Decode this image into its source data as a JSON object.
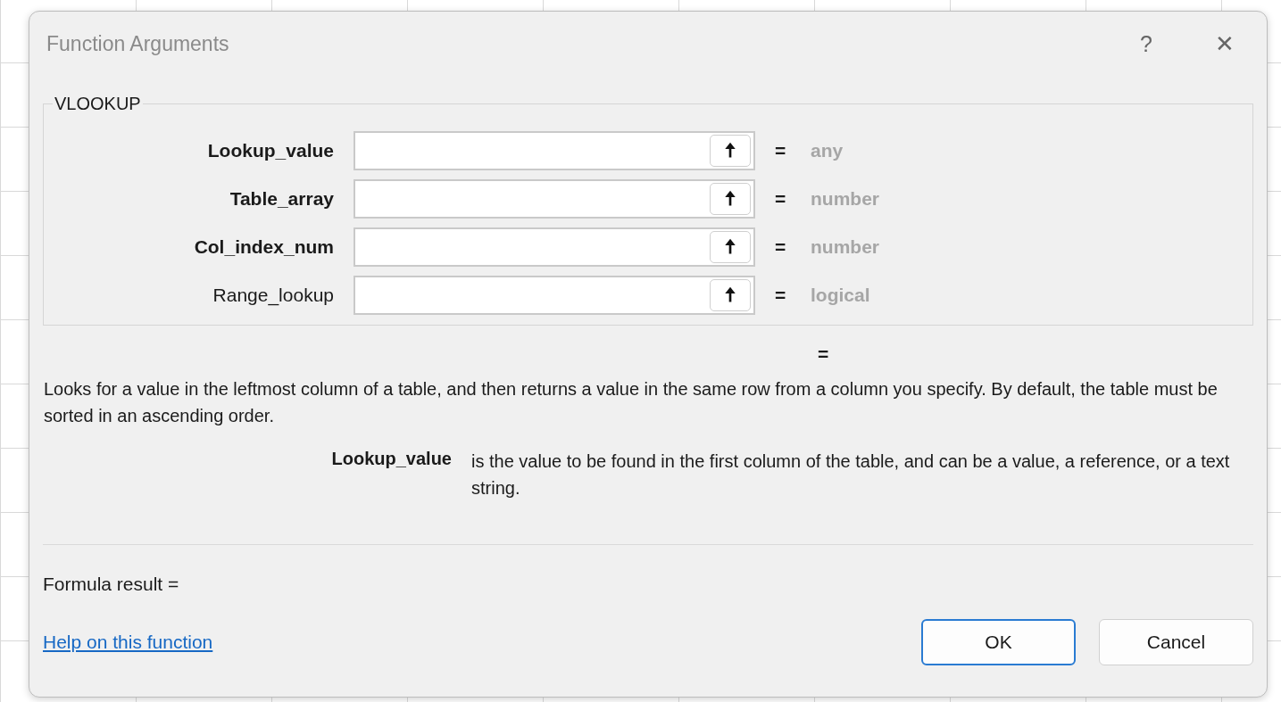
{
  "window": {
    "title": "Function Arguments",
    "help_glyph": "?",
    "close_glyph": "✕"
  },
  "group": {
    "title": "VLOOKUP"
  },
  "arguments": [
    {
      "name": "Lookup_value",
      "required": true,
      "button_glyph": "🠅",
      "equals": "=",
      "type": "any"
    },
    {
      "name": "Table_array",
      "required": true,
      "button_glyph": "🠅",
      "equals": "=",
      "type": "number"
    },
    {
      "name": "Col_index_num",
      "required": true,
      "button_glyph": "🠅",
      "equals": "=",
      "type": "number"
    },
    {
      "name": "Range_lookup",
      "required": false,
      "button_glyph": "🠅",
      "equals": "=",
      "type": "logical"
    }
  ],
  "result_equals": "=",
  "description": "Looks for a value in the leftmost column of a table, and then returns a value in the same row from a column you specify. By default, the table must be sorted in an ascending order.",
  "argument_help": {
    "name": "Lookup_value",
    "text": "is the value to be found in the first column of the table, and can be a value, a reference, or a text string."
  },
  "formula_result": "Formula result =",
  "help_link": "Help on this function",
  "buttons": [
    {
      "label": "OK",
      "default": true
    },
    {
      "label": "Cancel",
      "default": false
    }
  ]
}
